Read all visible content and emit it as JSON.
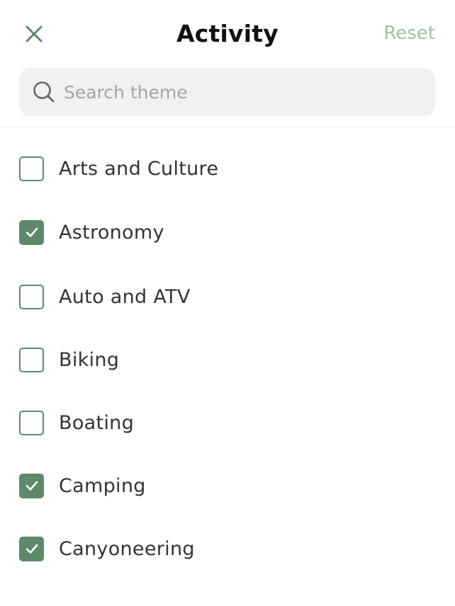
{
  "header": {
    "title": "Activity",
    "reset_label": "Reset",
    "close_icon": "close-icon"
  },
  "search": {
    "placeholder": "Search theme",
    "value": "",
    "icon": "search-icon"
  },
  "colors": {
    "accent": "#5e8a6a",
    "reset": "#a3bfa8",
    "search_bg": "#f1f1f1"
  },
  "activities": [
    {
      "label": "Arts and Culture",
      "checked": false
    },
    {
      "label": "Astronomy",
      "checked": true
    },
    {
      "label": "Auto and ATV",
      "checked": false
    },
    {
      "label": "Biking",
      "checked": false
    },
    {
      "label": "Boating",
      "checked": false
    },
    {
      "label": "Camping",
      "checked": true
    },
    {
      "label": "Canyoneering",
      "checked": true
    }
  ]
}
